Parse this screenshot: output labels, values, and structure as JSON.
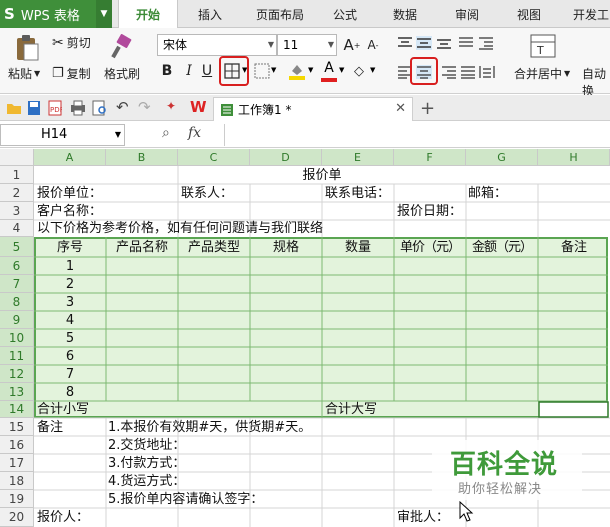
{
  "app": {
    "name": "WPS 表格",
    "logo": "S"
  },
  "tabs": [
    "开始",
    "插入",
    "页面布局",
    "公式",
    "数据",
    "审阅",
    "视图",
    "开发工"
  ],
  "ribbon": {
    "paste": "粘贴",
    "cut": "剪切",
    "copy": "复制",
    "format_painter": "格式刷",
    "font_name": "宋体",
    "font_size": "11",
    "merge_center": "合并居中",
    "auto_wrap": "自动换"
  },
  "doc_tab": "工作簿1 *",
  "name_box": "H14",
  "fx": "fx",
  "columns": [
    "A",
    "B",
    "C",
    "D",
    "E",
    "F",
    "G",
    "H"
  ],
  "rows": [
    "1",
    "2",
    "3",
    "4",
    "5",
    "6",
    "7",
    "8",
    "9",
    "10",
    "11",
    "12",
    "13",
    "14",
    "15",
    "16",
    "17",
    "18",
    "19",
    "20"
  ],
  "sheet": {
    "title": "报价单",
    "r2": {
      "a": "报价单位：",
      "c": "联系人：",
      "e": "联系电话：",
      "g": "邮箱："
    },
    "r3": {
      "a": "客户名称：",
      "f": "报价日期："
    },
    "r4": {
      "a": "以下价格为参考价格，如有任何问题请与我们联络"
    },
    "header": [
      "序号",
      "产品名称",
      "产品类型",
      "规格",
      "数量",
      "单价（元）",
      "金额（元）",
      "备注"
    ],
    "seq": [
      "1",
      "2",
      "3",
      "4",
      "5",
      "6",
      "7",
      "8"
    ],
    "r14": {
      "a": "合计小写",
      "e": "合计大写"
    },
    "notes_label": "备注",
    "notes": [
      "1.本报价有效期#天，供货期#天。",
      "2.交货地址：",
      "3.付款方式：",
      "4.货运方式：",
      "5.报价单内容请确认签字："
    ],
    "r20": {
      "a": "报价人：",
      "f": "审批人："
    }
  },
  "watermark": {
    "title": "百科全说",
    "subtitle": "助你轻松解决"
  },
  "colors": {
    "accent": "#3f8f3a",
    "selection": "#e3f3dc",
    "highlight": "#d81f1f"
  }
}
